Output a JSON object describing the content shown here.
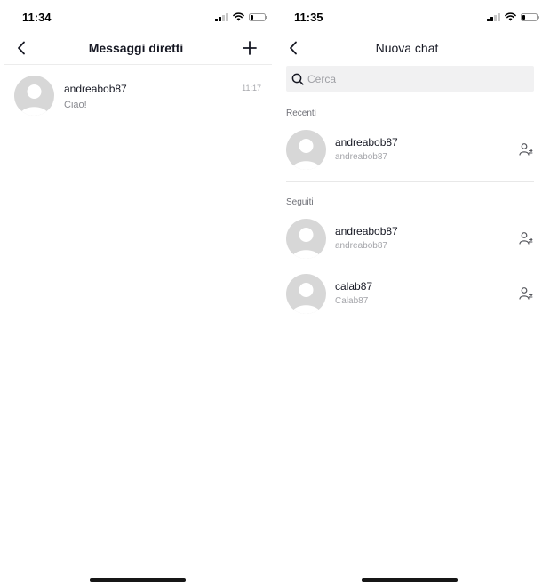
{
  "left": {
    "status": {
      "time": "11:34"
    },
    "header": {
      "title": "Messaggi diretti"
    },
    "conversations": [
      {
        "name": "andreabob87",
        "message": "Ciao!",
        "time": "11:17"
      }
    ]
  },
  "right": {
    "status": {
      "time": "11:35"
    },
    "header": {
      "title": "Nuova chat"
    },
    "search": {
      "placeholder": "Cerca",
      "value": ""
    },
    "sections": [
      {
        "label": "Recenti",
        "users": [
          {
            "name": "andreabob87",
            "handle": "andreabob87"
          }
        ]
      },
      {
        "label": "Seguiti",
        "users": [
          {
            "name": "andreabob87",
            "handle": "andreabob87"
          },
          {
            "name": "calab87",
            "handle": "Calab87"
          }
        ]
      }
    ]
  },
  "icons": {
    "signal": "signal-icon",
    "wifi": "wifi-icon",
    "battery": "battery-icon",
    "back": "chevron-left-icon",
    "new_chat": "plus-icon",
    "search": "search-icon",
    "avatar": "default-avatar-icon",
    "add_user": "person-swap-icon"
  },
  "battery_level": 0.2,
  "colors": {
    "text": "#161823",
    "secondary": "#8a8b91",
    "avatar_bg": "#d7d7d7",
    "search_bg": "#f1f1f2"
  }
}
